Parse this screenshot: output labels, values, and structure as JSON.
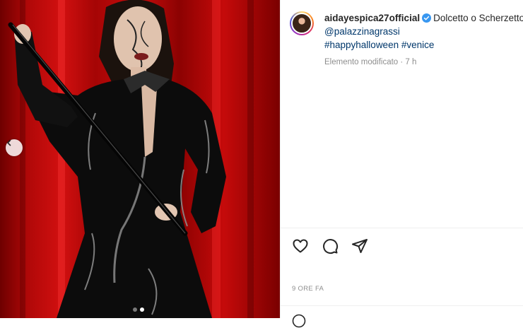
{
  "post": {
    "username": "aidayespica27official",
    "verified": true,
    "caption_text": "Dolcetto o Scherzetto",
    "mention": "@palazzinagrassi",
    "hashtags": [
      "#happyhalloween",
      "#venice"
    ],
    "edited_meta": "Elemento modificato · 7 h",
    "timestamp": "9 ORE FA"
  },
  "carousel": {
    "slide_count": 2,
    "active_index": 1
  },
  "colors": {
    "link": "#00376b",
    "muted": "#8e8e8e",
    "background_red": "#c80c0c"
  },
  "icons": {
    "prev": "chevron-left-icon",
    "like": "heart-icon",
    "comment": "comment-icon",
    "share": "share-icon",
    "verified": "verified-badge-icon",
    "emoji": "emoji-icon"
  }
}
